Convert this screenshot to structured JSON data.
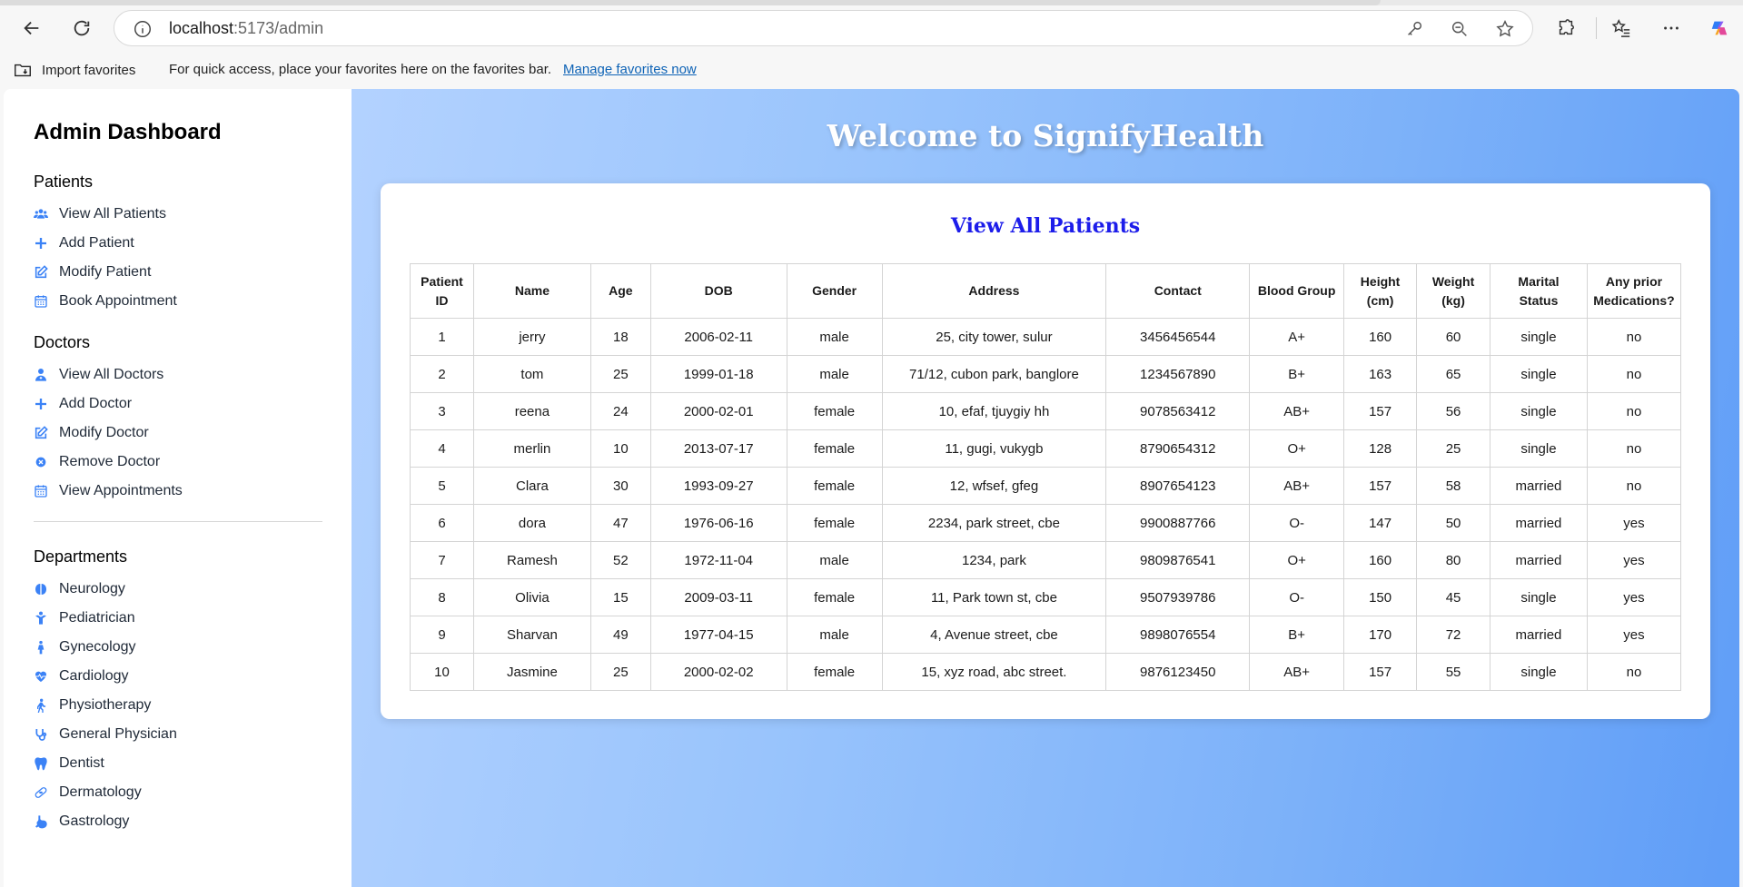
{
  "browser": {
    "url_host": "localhost",
    "url_path": ":5173/admin",
    "favorites_bar": {
      "import_label": "Import favorites",
      "hint": "For quick access, place your favorites here on the favorites bar.",
      "manage_link": "Manage favorites now"
    }
  },
  "sidebar": {
    "title": "Admin Dashboard",
    "sections": [
      {
        "title": "Patients",
        "items": [
          {
            "label": "View All Patients",
            "icon": "users-icon"
          },
          {
            "label": "Add Patient",
            "icon": "plus-icon"
          },
          {
            "label": "Modify Patient",
            "icon": "edit-icon"
          },
          {
            "label": "Book Appointment",
            "icon": "calendar-icon"
          }
        ]
      },
      {
        "title": "Doctors",
        "items": [
          {
            "label": "View All Doctors",
            "icon": "doctor-icon"
          },
          {
            "label": "Add Doctor",
            "icon": "plus-icon"
          },
          {
            "label": "Modify Doctor",
            "icon": "edit-icon"
          },
          {
            "label": "Remove Doctor",
            "icon": "remove-circle-icon"
          },
          {
            "label": "View Appointments",
            "icon": "calendar-icon"
          }
        ]
      },
      {
        "title": "Departments",
        "items": [
          {
            "label": "Neurology",
            "icon": "brain-icon"
          },
          {
            "label": "Pediatrician",
            "icon": "child-icon"
          },
          {
            "label": "Gynecology",
            "icon": "woman-icon"
          },
          {
            "label": "Cardiology",
            "icon": "heart-pulse-icon"
          },
          {
            "label": "Physiotherapy",
            "icon": "walking-icon"
          },
          {
            "label": "General Physician",
            "icon": "stethoscope-icon"
          },
          {
            "label": "Dentist",
            "icon": "tooth-icon"
          },
          {
            "label": "Dermatology",
            "icon": "bandage-icon"
          },
          {
            "label": "Gastrology",
            "icon": "stomach-icon"
          }
        ]
      }
    ]
  },
  "main": {
    "welcome": "Welcome to SignifyHealth",
    "card_title": "View All Patients",
    "table": {
      "headers": [
        [
          "Patient",
          "ID"
        ],
        [
          "Name"
        ],
        [
          "Age"
        ],
        [
          "DOB"
        ],
        [
          "Gender"
        ],
        [
          "Address"
        ],
        [
          "Contact"
        ],
        [
          "Blood Group"
        ],
        [
          "Height",
          "(cm)"
        ],
        [
          "Weight",
          "(kg)"
        ],
        [
          "Marital",
          "Status"
        ],
        [
          "Any prior",
          "Medications?"
        ]
      ],
      "rows": [
        [
          "1",
          "jerry",
          "18",
          "2006-02-11",
          "male",
          "25, city tower, sulur",
          "3456456544",
          "A+",
          "160",
          "60",
          "single",
          "no"
        ],
        [
          "2",
          "tom",
          "25",
          "1999-01-18",
          "male",
          "71/12, cubon park, banglore",
          "1234567890",
          "B+",
          "163",
          "65",
          "single",
          "no"
        ],
        [
          "3",
          "reena",
          "24",
          "2000-02-01",
          "female",
          "10, efaf, tjuygiy hh",
          "9078563412",
          "AB+",
          "157",
          "56",
          "single",
          "no"
        ],
        [
          "4",
          "merlin",
          "10",
          "2013-07-17",
          "female",
          "11, gugi, vukygb",
          "8790654312",
          "O+",
          "128",
          "25",
          "single",
          "no"
        ],
        [
          "5",
          "Clara",
          "30",
          "1993-09-27",
          "female",
          "12, wfsef, gfeg",
          "8907654123",
          "AB+",
          "157",
          "58",
          "married",
          "no"
        ],
        [
          "6",
          "dora",
          "47",
          "1976-06-16",
          "female",
          "2234, park street, cbe",
          "9900887766",
          "O-",
          "147",
          "50",
          "married",
          "yes"
        ],
        [
          "7",
          "Ramesh",
          "52",
          "1972-11-04",
          "male",
          "1234, park",
          "9809876541",
          "O+",
          "160",
          "80",
          "married",
          "yes"
        ],
        [
          "8",
          "Olivia",
          "15",
          "2009-03-11",
          "female",
          "11, Park town st, cbe",
          "9507939786",
          "O-",
          "150",
          "45",
          "single",
          "yes"
        ],
        [
          "9",
          "Sharvan",
          "49",
          "1977-04-15",
          "male",
          "4, Avenue street, cbe",
          "9898076554",
          "B+",
          "170",
          "72",
          "married",
          "yes"
        ],
        [
          "10",
          "Jasmine",
          "25",
          "2000-02-02",
          "female",
          "15, xyz road, abc street.",
          "9876123450",
          "AB+",
          "157",
          "55",
          "single",
          "no"
        ]
      ]
    }
  },
  "colors": {
    "accent": "#3b82f6",
    "card_title": "#1d1dea",
    "gradient_start": "#b3d2ff",
    "gradient_end": "#5f9df7"
  }
}
